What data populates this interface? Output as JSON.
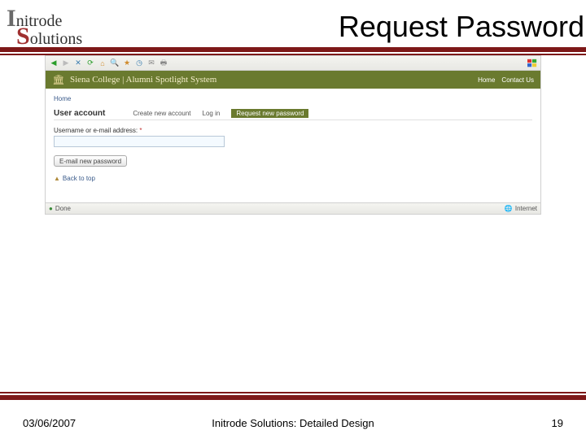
{
  "logo": {
    "line1_initial": "I",
    "line1_rest": "nitrode",
    "line2_initial": "S",
    "line2_rest": "olutions"
  },
  "slide_title": "Request Password",
  "browser": {
    "site_title": "Siena College | Alumni Spotlight System",
    "nav": {
      "home": "Home",
      "contact": "Contact Us"
    },
    "breadcrumb": "Home",
    "page_heading": "User account",
    "tabs": {
      "create": "Create new account",
      "login": "Log in",
      "request": "Request new password"
    },
    "field_label": "Username or e-mail address:",
    "field_required_marker": "*",
    "field_value": "",
    "submit_label": "E-mail new password",
    "back_to_top": "Back to top",
    "status_left": "Done",
    "status_right": "Internet"
  },
  "footer": {
    "date": "03/06/2007",
    "center": "Initrode Solutions: Detailed Design",
    "page": "19"
  }
}
